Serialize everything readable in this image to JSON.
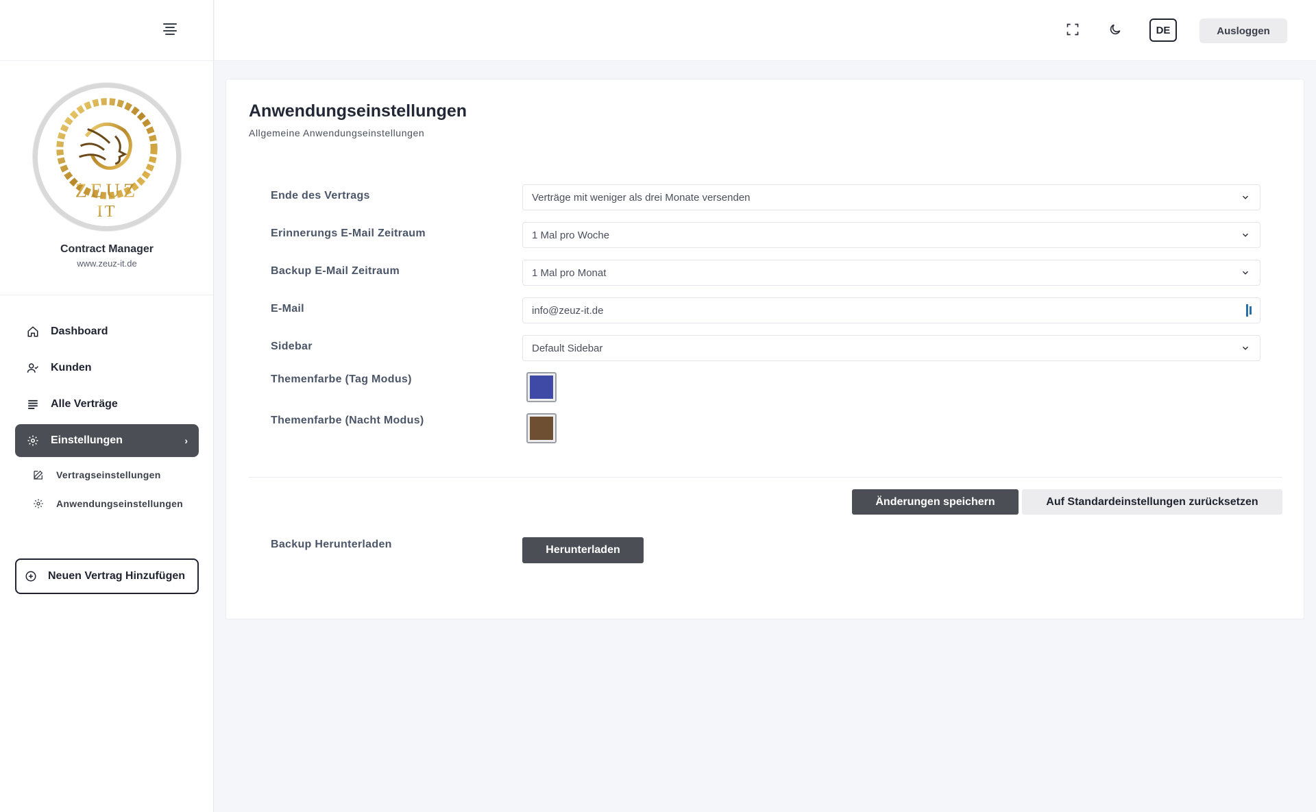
{
  "sidebar": {
    "app_name": "Contract Manager",
    "app_url": "www.zeuz-it.de",
    "logo_text_top": "ZEUZ",
    "logo_text_bottom": "IT",
    "nav": [
      {
        "label": "Dashboard",
        "icon": "home-icon"
      },
      {
        "label": "Kunden",
        "icon": "user-check-icon"
      },
      {
        "label": "Alle Verträge",
        "icon": "list-icon"
      },
      {
        "label": "Einstellungen",
        "icon": "gear-icon",
        "active": true
      }
    ],
    "sub_items": [
      {
        "label": "Vertragseinstellungen",
        "icon": "edit-icon"
      },
      {
        "label": "Anwendungseinstellungen",
        "icon": "gear-icon"
      }
    ],
    "add_button": "Neuen Vertrag Hinzufügen"
  },
  "topbar": {
    "language": "DE",
    "logout_label": "Ausloggen"
  },
  "page": {
    "title": "Anwendungseinstellungen",
    "subtitle": "Allgemeine Anwendungseinstellungen"
  },
  "settings": {
    "contract_end": {
      "label": "Ende des Vertrags",
      "value": "Verträge mit weniger als drei Monate versenden"
    },
    "reminder_period": {
      "label": "Erinnerungs E-Mail Zeitraum",
      "value": "1 Mal pro Woche"
    },
    "backup_period": {
      "label": "Backup E-Mail Zeitraum",
      "value": "1 Mal pro Monat"
    },
    "email": {
      "label": "E-Mail",
      "value": "info@zeuz-it.de"
    },
    "sidebar": {
      "label": "Sidebar",
      "value": "Default Sidebar"
    },
    "theme_day": {
      "label": "Themenfarbe (Tag Modus)",
      "color": "#3f4aa6"
    },
    "theme_night": {
      "label": "Themenfarbe (Nacht Modus)",
      "color": "#6f4f31"
    }
  },
  "actions": {
    "save_label": "Änderungen speichern",
    "reset_label": "Auf Standardeinstellungen zurücksetzen"
  },
  "backup": {
    "label": "Backup Herunterladen",
    "button_label": "Herunterladen"
  }
}
